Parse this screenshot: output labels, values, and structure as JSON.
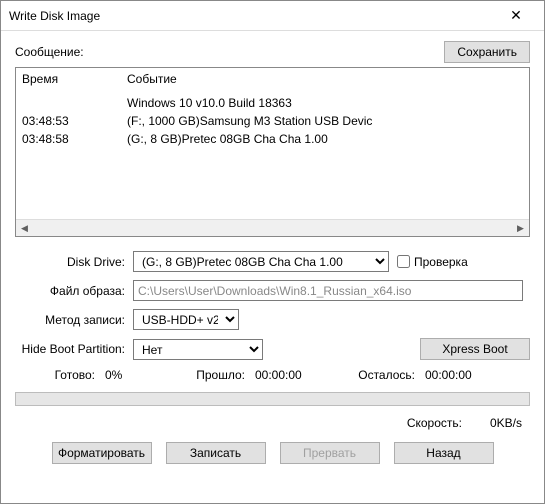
{
  "window": {
    "title": "Write Disk Image"
  },
  "labels": {
    "message": "Сообщение:",
    "save": "Сохранить",
    "time": "Время",
    "event": "Событие",
    "disk_drive": "Disk Drive:",
    "file_image": "Файл образа:",
    "write_method": "Метод записи:",
    "hide_boot": "Hide Boot Partition:",
    "check": "Проверка",
    "ready": "Готово:",
    "elapsed": "Прошло:",
    "remaining": "Осталось:",
    "speed": "Скорость:",
    "xpress_boot": "Xpress Boot"
  },
  "log": [
    {
      "time": "",
      "event": "Windows 10 v10.0 Build 18363"
    },
    {
      "time": "03:48:53",
      "event": "(F:, 1000 GB)Samsung M3 Station USB Devic"
    },
    {
      "time": "03:48:58",
      "event": "(G:, 8 GB)Pretec  08GB Cha Cha   1.00"
    }
  ],
  "form": {
    "disk_drive": "(G:, 8 GB)Pretec  08GB Cha Cha   1.00",
    "file_image": "C:\\Users\\User\\Downloads\\Win8.1_Russian_x64.iso",
    "write_method": "USB-HDD+ v2",
    "hide_boot": "Нет"
  },
  "progress": {
    "ready_pct": "0%",
    "elapsed": "00:00:00",
    "remaining": "00:00:00",
    "speed": "0KB/s"
  },
  "buttons": {
    "format": "Форматировать",
    "write": "Записать",
    "abort": "Прервать",
    "back": "Назад"
  }
}
